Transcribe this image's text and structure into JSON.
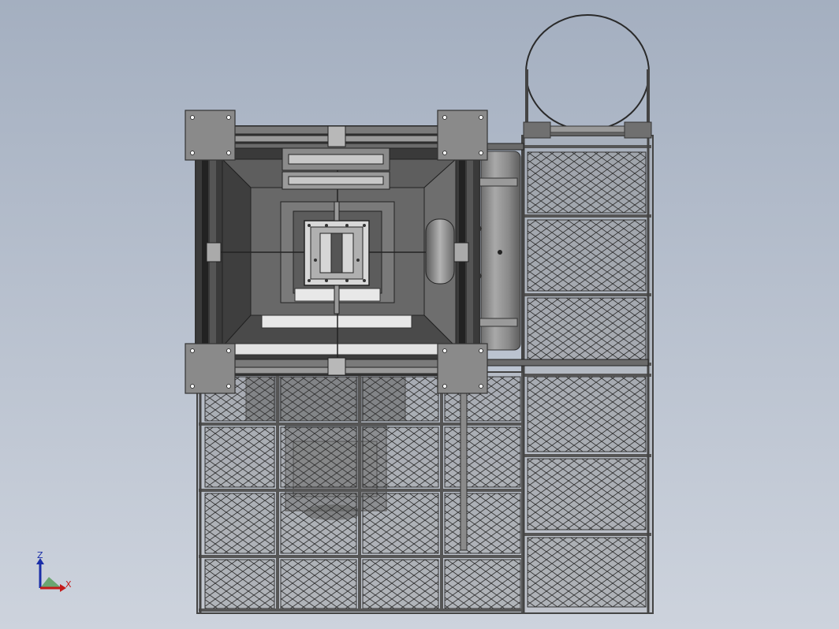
{
  "view": {
    "background_top": "#a4afc0",
    "background_bottom": "#cdd3dd"
  },
  "model": {
    "steel_color": "#5a5a5a",
    "plate_color": "#8a8a8a",
    "mesh_color": "#3c3c3c",
    "dark_interior": "#2e2e2e",
    "tank_color": "#8c8c8c",
    "ring_color": "#2a2a2a"
  },
  "triad": {
    "z_label": "Z",
    "x_label": "X",
    "z_color": "#1a2ea8",
    "x_color": "#c41a1a",
    "y_color": "#2a8a2a"
  }
}
